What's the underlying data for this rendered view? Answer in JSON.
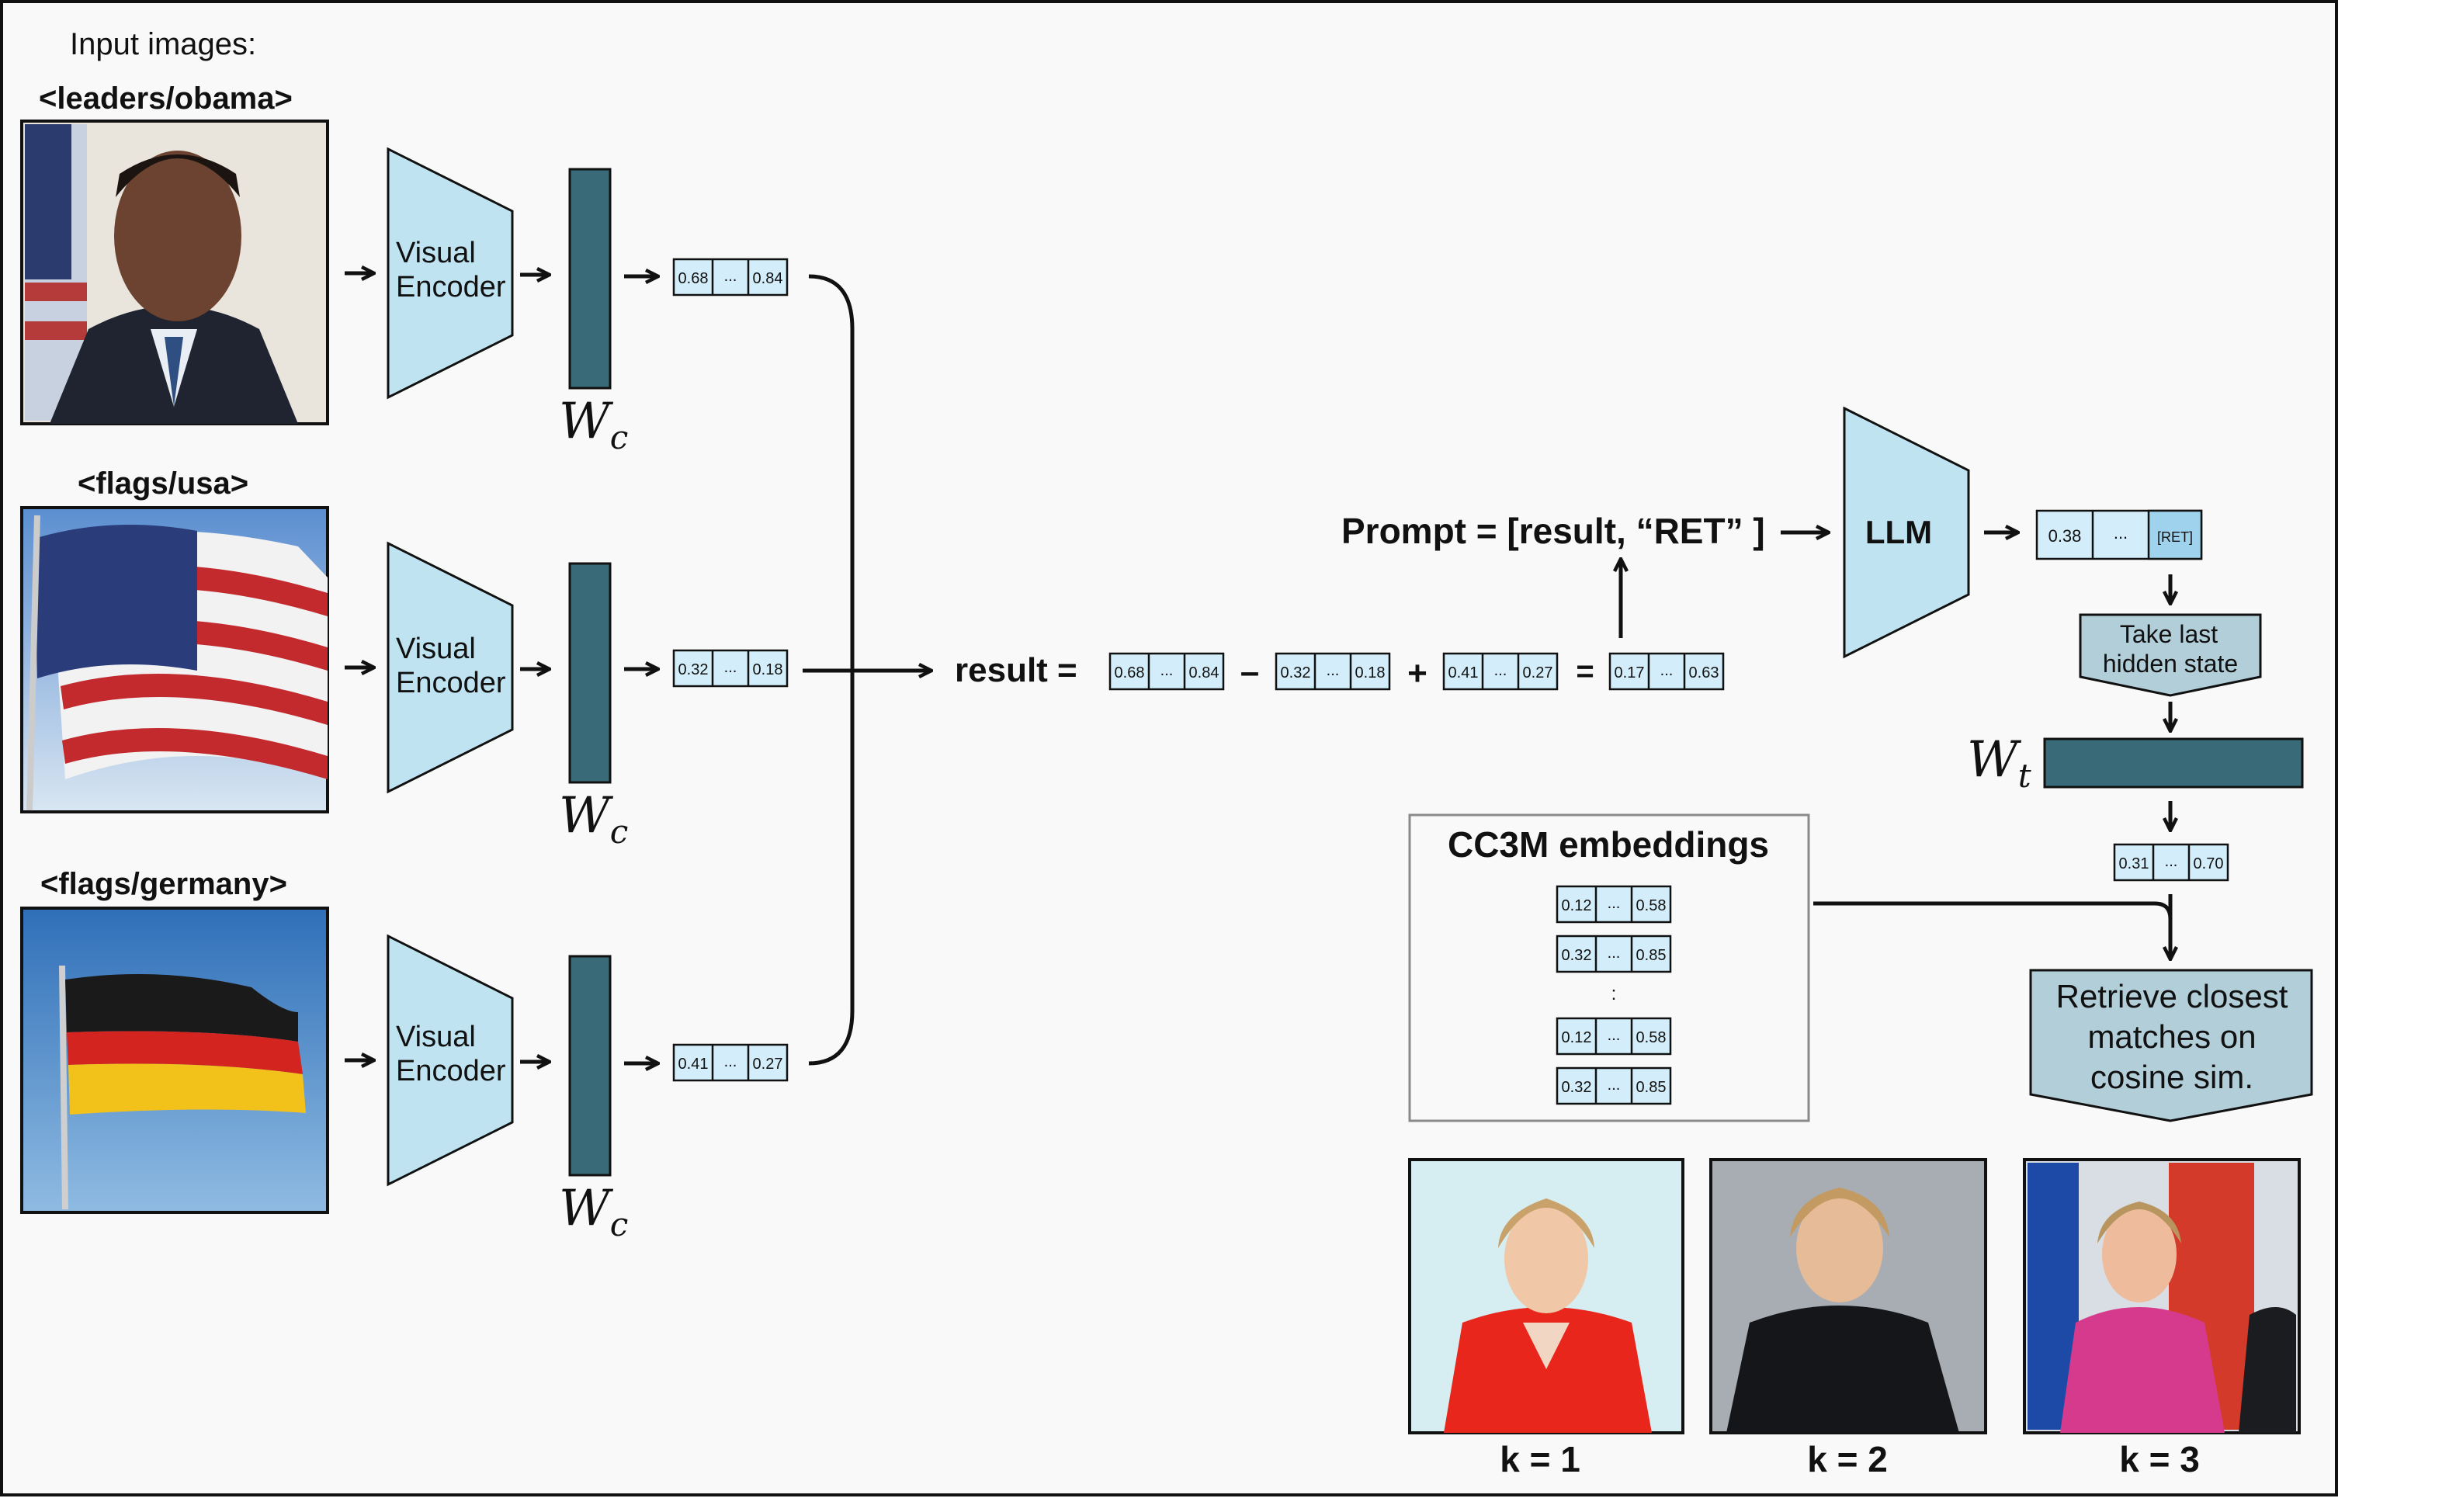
{
  "inputs_title": "Input images:",
  "input_labels": [
    "<leaders/obama>",
    "<flags/usa>",
    "<flags/germany>"
  ],
  "encoder_label_line1": "Visual",
  "encoder_label_line2": "Encoder",
  "wc_main": "W",
  "wc_sub": "c",
  "wt_main": "W",
  "wt_sub": "t",
  "vectors": {
    "obama": [
      "0.68",
      "...",
      "0.84"
    ],
    "usa": [
      "0.32",
      "...",
      "0.18"
    ],
    "germany": [
      "0.41",
      "...",
      "0.27"
    ],
    "result": [
      "0.17",
      "...",
      "0.63"
    ],
    "llm_out": [
      "0.38",
      "...",
      "[RET]"
    ],
    "wt_out": [
      "0.31",
      "...",
      "0.70"
    ]
  },
  "equation": {
    "label": "result =",
    "minus": "–",
    "plus": "+",
    "equals": "="
  },
  "prompt_text": "Prompt = [result, “RET” ]",
  "llm_label": "LLM",
  "take_last_line1": "Take last",
  "take_last_line2": "hidden state",
  "cc3m_title": "CC3M embeddings",
  "cc3m_rows": [
    [
      "0.12",
      "...",
      "0.58"
    ],
    [
      "0.32",
      "...",
      "0.85"
    ],
    [
      "0.12",
      "...",
      "0.58"
    ],
    [
      "0.32",
      "...",
      "0.85"
    ]
  ],
  "cc3m_ellipsis": ":",
  "retrieve_line1": "Retrieve closest",
  "retrieve_line2": "matches on",
  "retrieve_line3": "cosine sim.",
  "k_labels": [
    "k = 1",
    "k = 2",
    "k = 3"
  ],
  "colors": {
    "encoder": "#bfe3f0",
    "weight": "#386a78",
    "vector": "#d3eefa",
    "ret_cell": "#9fd2ec",
    "panel": "#b2ced9"
  }
}
